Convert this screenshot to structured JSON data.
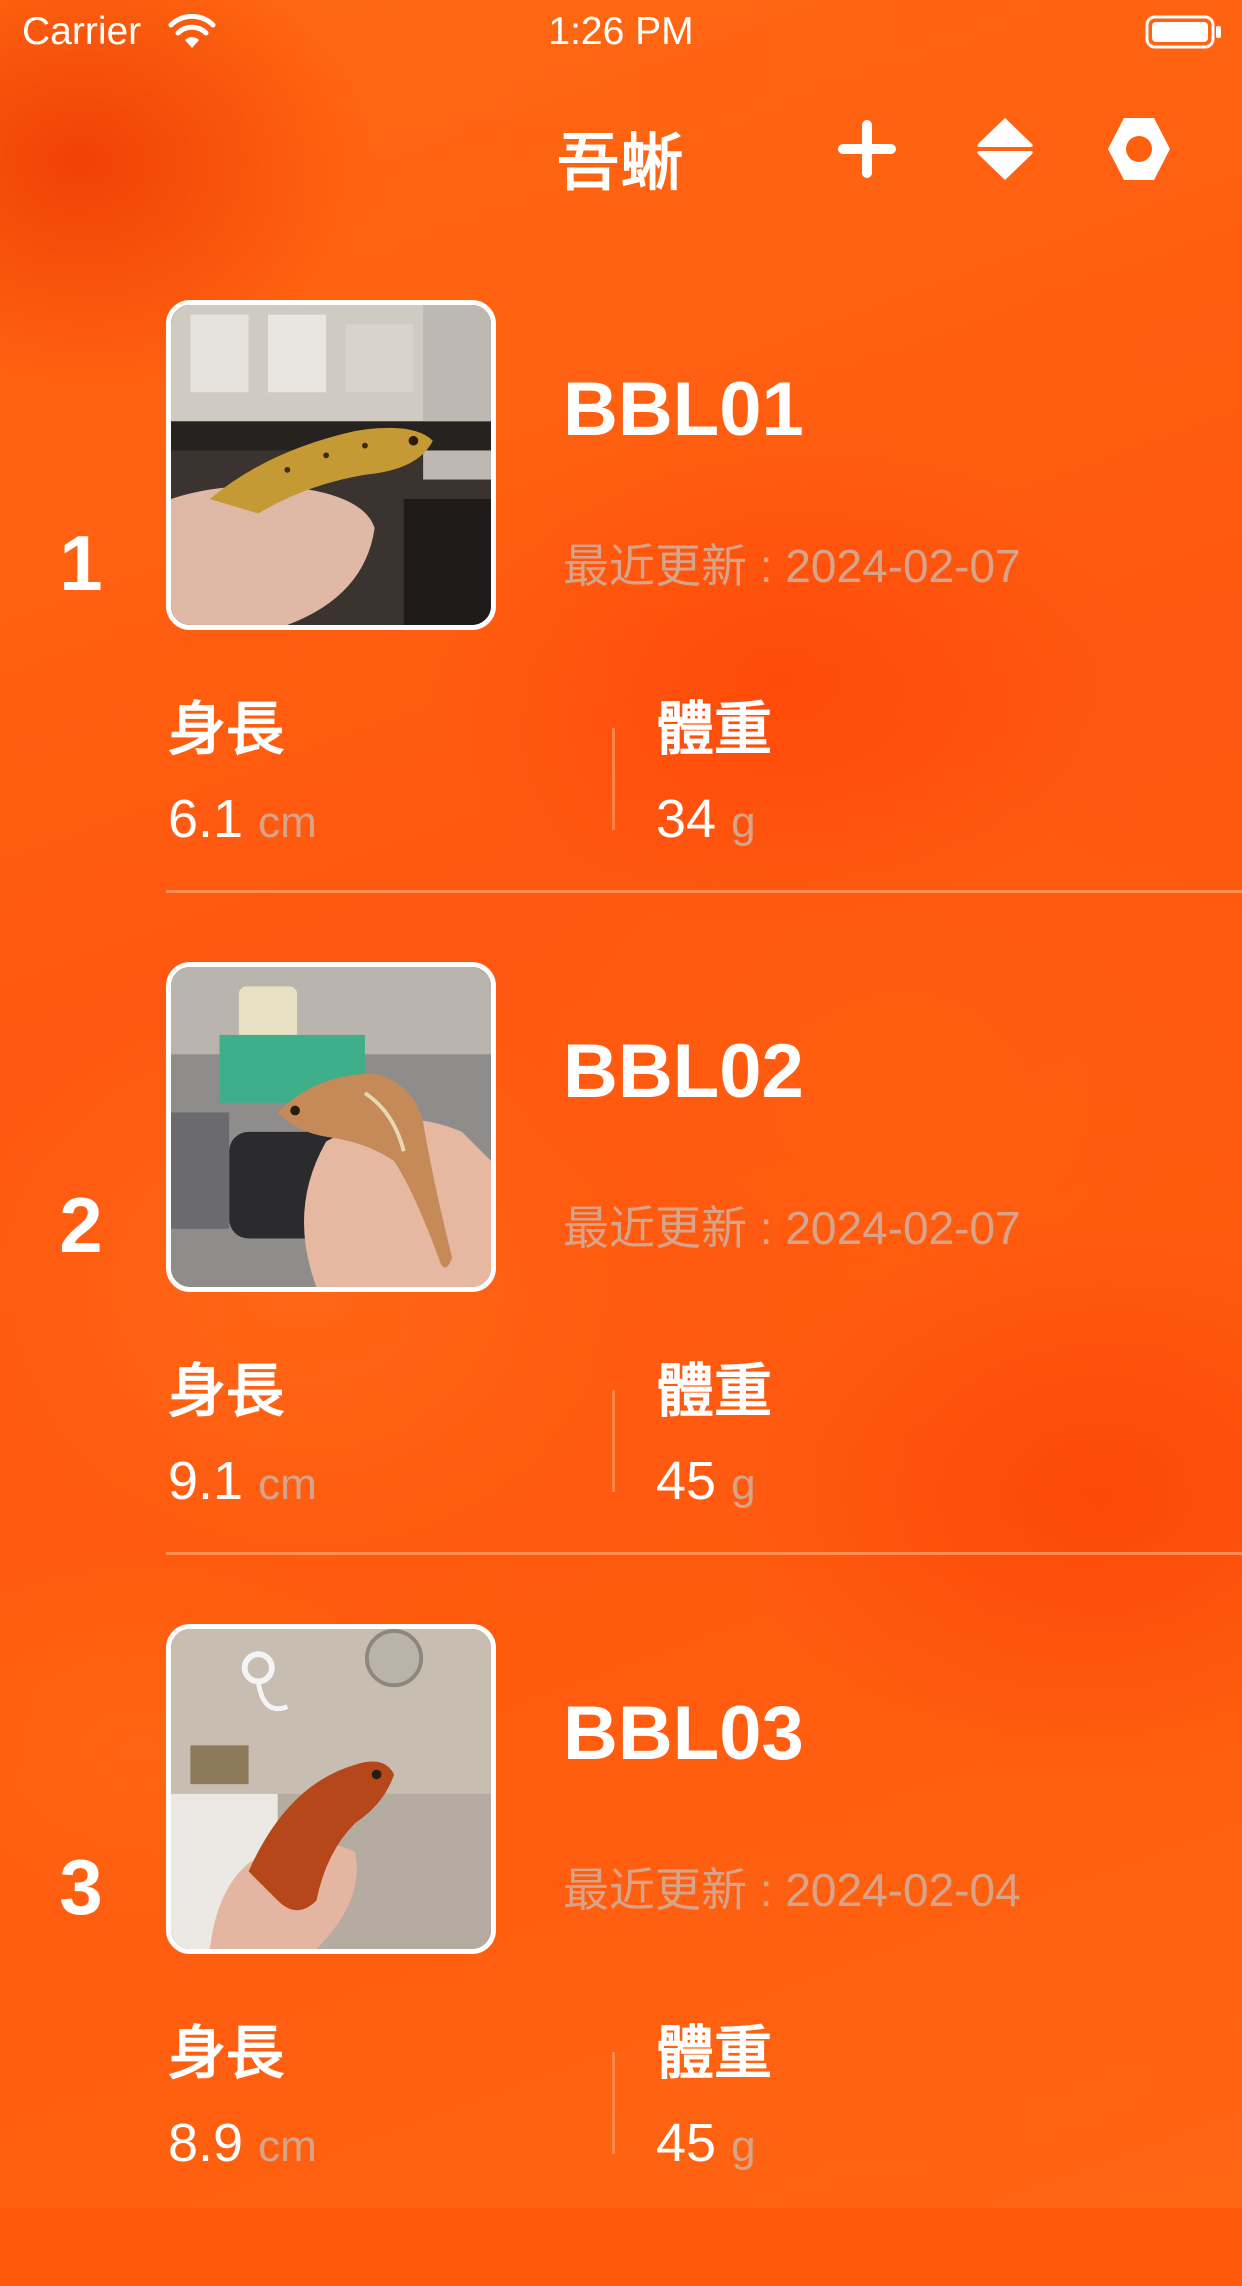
{
  "status_bar": {
    "carrier": "Carrier",
    "time": "1:26 PM",
    "wifi_icon": "wifi-icon",
    "battery_icon": "battery-icon"
  },
  "nav": {
    "title": "吾蜥",
    "add_icon": "plus-icon",
    "sort_icon": "sort-icon",
    "settings_icon": "gear-icon"
  },
  "colors": {
    "background": "#ff5a0e",
    "text_primary": "#ffffff",
    "text_secondary": "#d7a48a"
  },
  "stat_labels": {
    "length": "身長",
    "weight": "體重"
  },
  "units": {
    "length": "cm",
    "weight": "g"
  },
  "geckos": [
    {
      "index": "1",
      "name": "BBL01",
      "updated": "最近更新 : 2024-02-07",
      "length": "6.1",
      "weight": "34"
    },
    {
      "index": "2",
      "name": "BBL02",
      "updated": "最近更新 : 2024-02-07",
      "length": "9.1",
      "weight": "45"
    },
    {
      "index": "3",
      "name": "BBL03",
      "updated": "最近更新 : 2024-02-04",
      "length": "8.9",
      "weight": "45"
    }
  ]
}
